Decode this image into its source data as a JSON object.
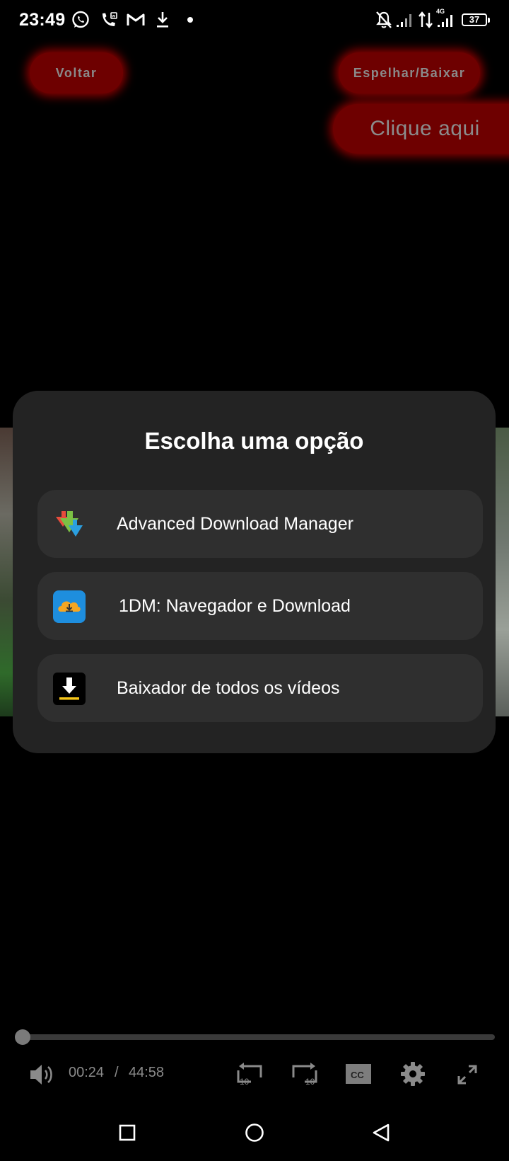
{
  "status_bar": {
    "time": "23:49",
    "network_label": "4G",
    "battery_level": "37",
    "icons": [
      "whatsapp-icon",
      "wifi-call-icon",
      "gmail-icon",
      "download-icon",
      "dot-icon",
      "muted-bell-icon",
      "signal-icon",
      "data-arrows-icon",
      "signal-4g-icon",
      "battery-icon"
    ]
  },
  "top_buttons": {
    "back_label": "Voltar",
    "mirror_download_label": "Espelhar/Baixar",
    "click_here_label": "Clique aqui"
  },
  "dialog": {
    "title": "Escolha uma opção",
    "options": [
      {
        "label": "Advanced Download Manager",
        "icon": "adm-app-icon"
      },
      {
        "label": "1DM: Navegador e Download",
        "icon": "1dm-app-icon"
      },
      {
        "label": "Baixador de todos os vídeos",
        "icon": "video-downloader-app-icon"
      }
    ]
  },
  "player": {
    "current_time": "00:24",
    "separator": "/",
    "total_time": "44:58",
    "progress_fraction": 0.009,
    "controls": [
      "volume-icon",
      "rewind-10-icon",
      "forward-10-icon",
      "cc-icon",
      "settings-gear-icon",
      "fullscreen-icon"
    ],
    "rewind_label": "10",
    "forward_label": "10",
    "cc_label": "CC"
  },
  "colors": {
    "accent_red": "#6e0000",
    "glow_red": "#be0000",
    "dialog_bg": "#232323",
    "option_bg": "#2f2f2f"
  }
}
